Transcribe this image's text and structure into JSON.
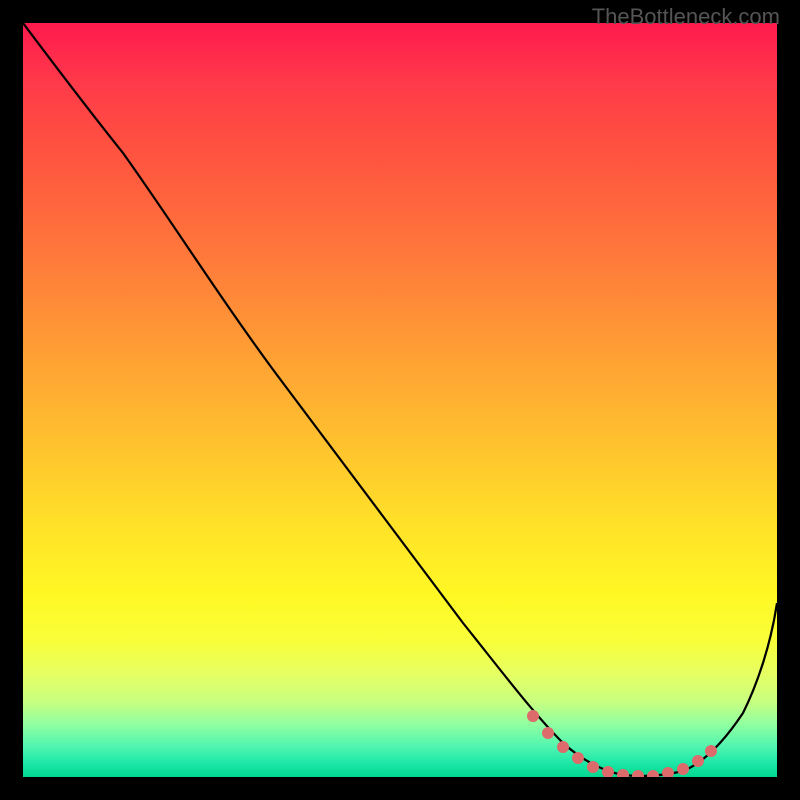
{
  "watermark": "TheBottleneck.com",
  "chart_data": {
    "type": "line",
    "title": "",
    "xlabel": "",
    "ylabel": "",
    "xlim": [
      0,
      100
    ],
    "ylim": [
      0,
      100
    ],
    "series": [
      {
        "name": "bottleneck-curve",
        "color": "#000000",
        "x": [
          0,
          5,
          12,
          20,
          30,
          40,
          50,
          60,
          68,
          72,
          75,
          78,
          80,
          82,
          84,
          86,
          88,
          90,
          94,
          100
        ],
        "y": [
          100,
          95,
          88,
          78,
          65,
          52,
          39,
          26,
          14,
          8,
          4,
          2,
          1,
          0.5,
          0.5,
          1,
          2,
          4,
          12,
          27
        ]
      },
      {
        "name": "highlight-markers",
        "color": "#e06666",
        "type": "scatter",
        "x": [
          68,
          70,
          72,
          74,
          76,
          78,
          80,
          82,
          84,
          86,
          88,
          90
        ],
        "y": [
          14,
          11,
          8,
          6,
          4,
          2,
          1,
          0.5,
          0.5,
          1,
          2,
          4
        ]
      }
    ],
    "gradient_stops": [
      {
        "pos": 0,
        "color": "#ff1a4d"
      },
      {
        "pos": 50,
        "color": "#ffc22e"
      },
      {
        "pos": 80,
        "color": "#fff824"
      },
      {
        "pos": 100,
        "color": "#00d890"
      }
    ]
  }
}
